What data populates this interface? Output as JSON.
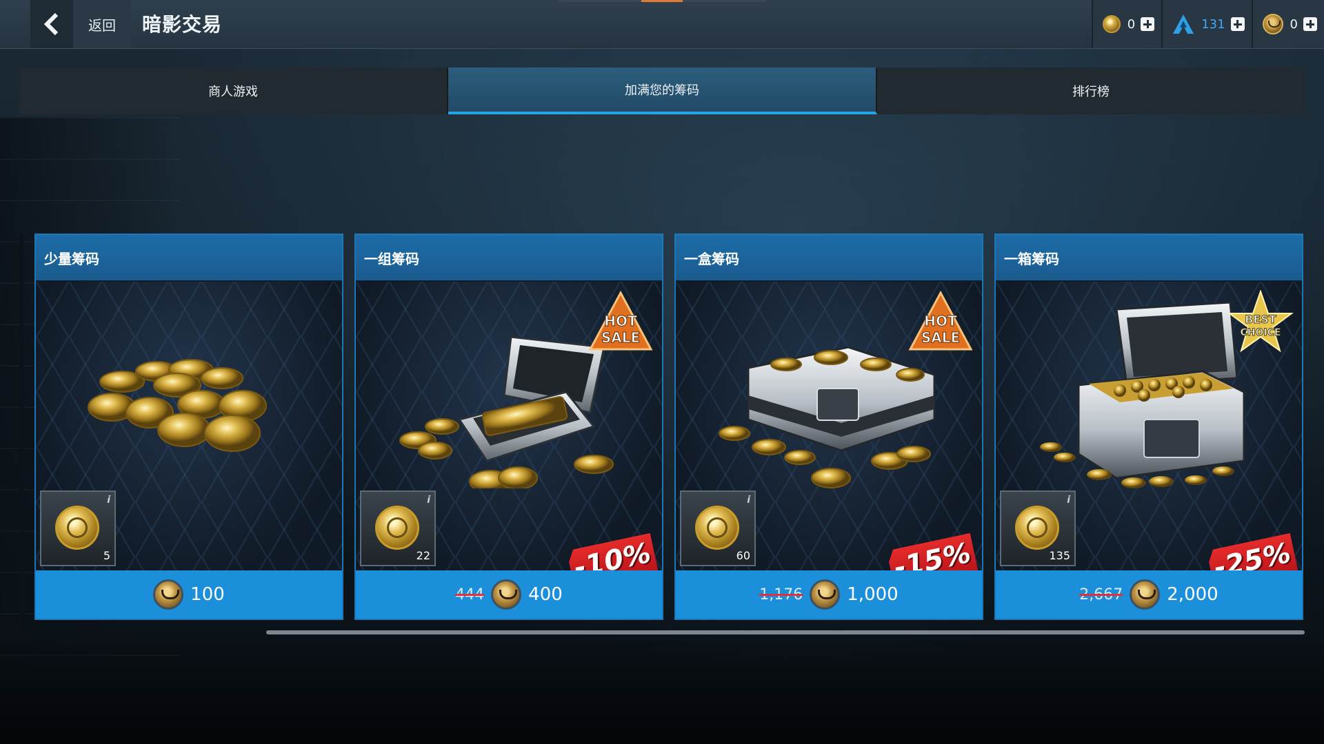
{
  "header": {
    "back_label": "返回",
    "title": "暗影交易"
  },
  "currencies": [
    {
      "icon": "gold-coin-icon",
      "value": "0"
    },
    {
      "icon": "blue-a-icon",
      "value": "131"
    },
    {
      "icon": "token-icon",
      "value": "0"
    }
  ],
  "tabs": [
    {
      "label": "商人游戏",
      "active": false
    },
    {
      "label": "加满您的筹码",
      "active": true
    },
    {
      "label": "排行榜",
      "active": false
    }
  ],
  "cards": [
    {
      "title": "少量筹码",
      "qty": "5",
      "info": "i",
      "old_price": "",
      "price": "100",
      "discount": "",
      "badge": ""
    },
    {
      "title": "一组筹码",
      "qty": "22",
      "info": "i",
      "old_price": "444",
      "price": "400",
      "discount": "-10%",
      "badge": "HOT SALE"
    },
    {
      "title": "一盒筹码",
      "qty": "60",
      "info": "i",
      "old_price": "1,176",
      "price": "1,000",
      "discount": "-15%",
      "badge": "HOT SALE"
    },
    {
      "title": "一箱筹码",
      "qty": "135",
      "info": "i",
      "old_price": "2,667",
      "price": "2,000",
      "discount": "-25%",
      "badge": "BEST CHOICE"
    }
  ],
  "badges": {
    "hot": [
      "HOT",
      "SALE"
    ],
    "best": [
      "BEST",
      "CHOICE"
    ]
  },
  "colors": {
    "accent": "#1c8fdb",
    "tab_active": "#2aa3e6",
    "discount": "#e52b2b"
  }
}
